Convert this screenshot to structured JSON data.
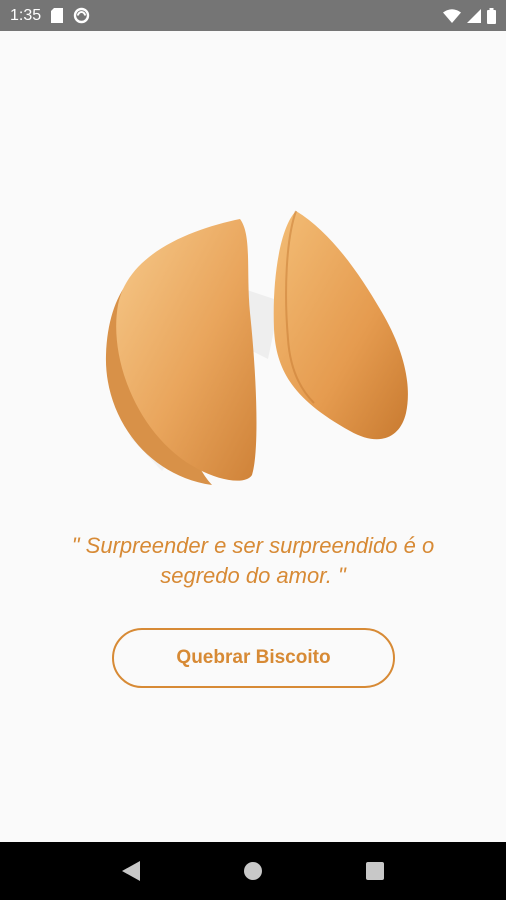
{
  "status_bar": {
    "time": "1:35",
    "icons": [
      "sd-card-icon",
      "sync-icon",
      "wifi-icon",
      "signal-icon",
      "battery-icon"
    ]
  },
  "main": {
    "phrase": "\" Surpreender e ser surpreendido é o segredo do amor. \"",
    "button_label": "Quebrar Biscoito",
    "image": "fortune-cookie-image"
  },
  "colors": {
    "accent": "#d78a35",
    "background": "#fafafa",
    "status_bar": "#757575",
    "nav_bar": "#000000"
  },
  "nav_bar": {
    "buttons": [
      "back-icon",
      "home-icon",
      "recents-icon"
    ]
  }
}
